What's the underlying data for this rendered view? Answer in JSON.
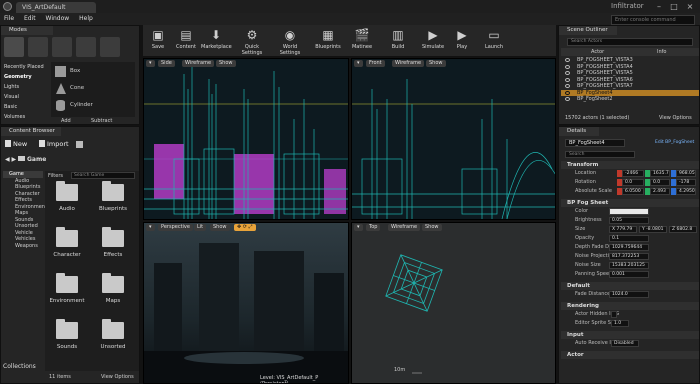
{
  "window": {
    "tab_label": "VIS_ArtDefault",
    "app_title": "Infiltrator",
    "search_console_placeholder": "Enter console command"
  },
  "menu": [
    "File",
    "Edit",
    "Window",
    "Help"
  ],
  "modes": {
    "tab": "Modes",
    "categories": [
      "Recently Placed",
      "Geometry",
      "Lights",
      "Visual",
      "Basic",
      "Volumes"
    ],
    "items": [
      "Box",
      "Cone",
      "Cylinder"
    ],
    "footer": [
      "Add",
      "Subtract"
    ]
  },
  "content_browser": {
    "tab": "Content Browser",
    "new_label": "New",
    "import_label": "Import",
    "path_label": "Game",
    "filters_label": "Filters",
    "search_placeholder": "Search Game",
    "tree": [
      "Game",
      "Audio",
      "Blueprints",
      "Character",
      "Effects",
      "Environment",
      "Maps",
      "Sounds",
      "Unsorted",
      "Vehicle",
      "Vehicles",
      "Weapons"
    ],
    "folders": [
      "Audio",
      "Blueprints",
      "Character",
      "Effects",
      "Environment",
      "Maps",
      "Sounds",
      "Unsorted"
    ],
    "item_count": "11 items",
    "view_options": "View Options",
    "collections_label": "Collections"
  },
  "toolbar": {
    "buttons": [
      "Save",
      "Content",
      "Marketplace",
      "Quick Settings",
      "World Settings",
      "Blueprints",
      "Matinee",
      "Build",
      "Simulate",
      "Play",
      "Launch"
    ]
  },
  "viewports": {
    "side": {
      "mode": "Side",
      "view": "Wireframe",
      "show": "Show"
    },
    "front": {
      "mode": "Front",
      "view": "Wireframe",
      "show": "Show"
    },
    "perspective": {
      "mode": "Perspective",
      "view": "Lit",
      "show": "Show"
    },
    "top": {
      "mode": "Top",
      "view": "Wireframe",
      "show": "Show"
    },
    "level_label": "Level:  VIS_ArtDefault_P (Persistent)",
    "scale_label": "10m"
  },
  "scene_outliner": {
    "tab": "Scene Outliner",
    "search_placeholder": "Search Actors",
    "col_actor": "Actor",
    "col_info": "Info",
    "rows": [
      "BP_FOGSHEET_VISTA3",
      "BP_FOGSHEET_VISTA4",
      "BP_FOGSHEET_VISTA5",
      "BP_FOGSHEET_VISTA6",
      "BP_FOGSHEET_VISTA7",
      "BP_FogSheet4",
      "BP_FogSheet2"
    ],
    "selected_index": 5,
    "status": "15702 actors (1 selected)",
    "view_options": "View Options"
  },
  "details": {
    "tab": "Details",
    "actor_name": "BP_FogSheet4",
    "edit_blueprint": "Edit BP_FogSheet",
    "search_placeholder": "Search",
    "transform_section": "Transform",
    "location_label": "Location",
    "rotation_label": "Rotation",
    "scale_label": "Absolute Scale",
    "location": [
      "-2466",
      "1635.7",
      "968.05"
    ],
    "rotation": [
      "0.0",
      "0.0",
      "-178"
    ],
    "scale": [
      "6.0500",
      "2.493",
      "4.2950"
    ],
    "fog_section": "BP Fog Sheet",
    "props": [
      {
        "label": "Color",
        "value": ""
      },
      {
        "label": "Brightness",
        "value": "0.05"
      },
      {
        "label": "Size",
        "value": "X 779.79"
      },
      {
        "label": "Opacity",
        "value": "0.1"
      },
      {
        "label": "Depth Fade Dist",
        "value": "1029.759644"
      },
      {
        "label": "Noise Projection",
        "value": "817.372253"
      },
      {
        "label": "Noise Size",
        "value": "15383.203125"
      },
      {
        "label": "Panning Speed",
        "value": "0.001"
      }
    ],
    "size_extra": [
      "Y -8.0801",
      "Z 6802.8"
    ],
    "default_section": "Default",
    "fade_distance_label": "Fade Distance",
    "fade_distance_value": "1024.0",
    "rendering_section": "Rendering",
    "actor_hidden_label": "Actor Hidden In G",
    "editor_sprite_label": "Editor Sprite Sca",
    "editor_sprite_value": "1.0",
    "input_section": "Input",
    "auto_receive_label": "Auto Receive Inp",
    "auto_receive_value": "Disabled",
    "actor_section": "Actor"
  },
  "colors": {
    "wire": "#1fb5b0",
    "magenta": "#b13cc4",
    "selection": "#b07a24",
    "accent_orange": "#e8a33a"
  }
}
